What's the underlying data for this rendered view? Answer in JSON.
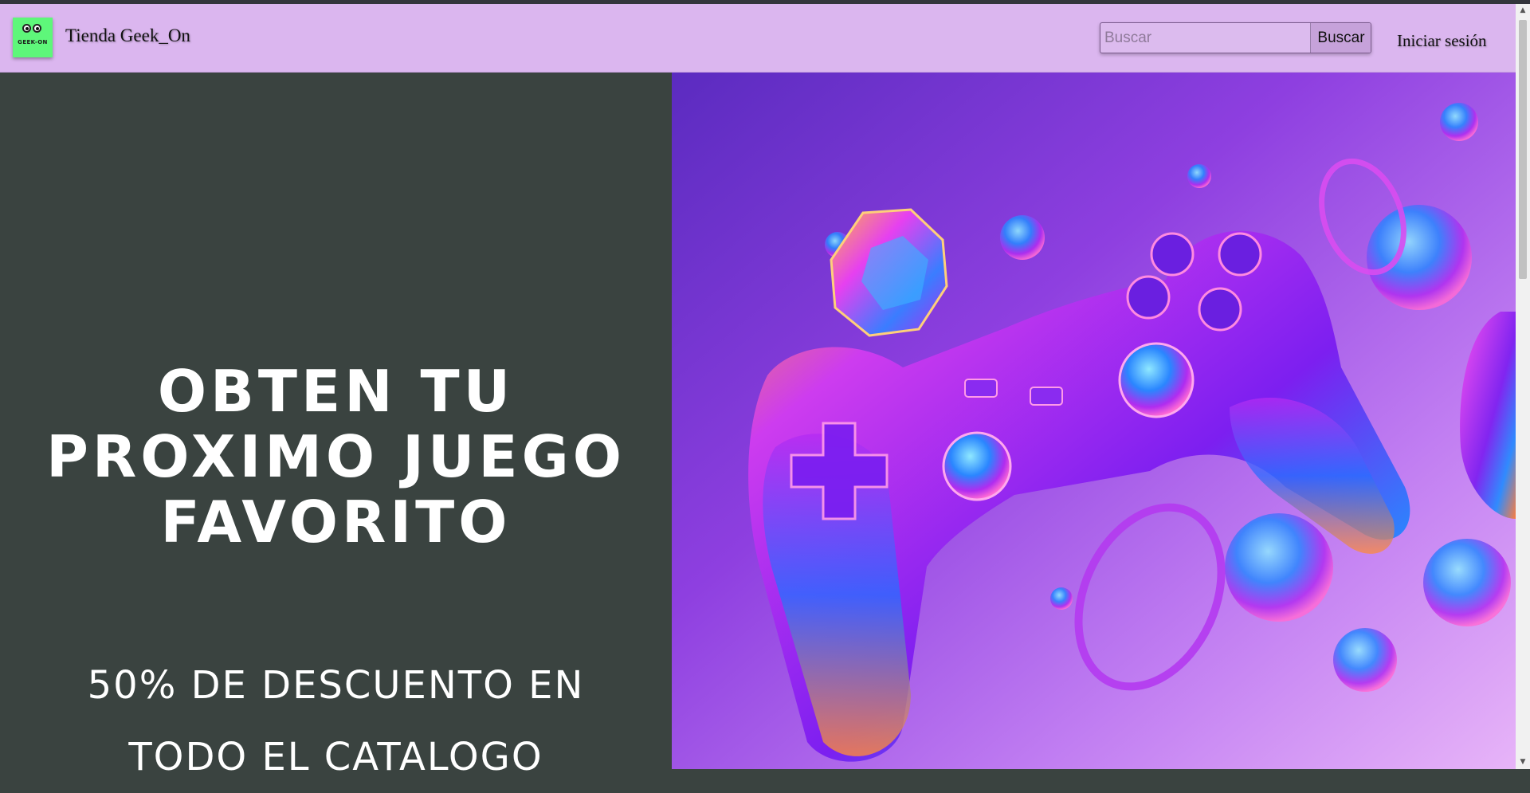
{
  "header": {
    "logo_text": "GEEK-ON",
    "brand": "Tienda Geek_On",
    "search": {
      "placeholder": "Buscar",
      "value": "",
      "button_label": "Buscar"
    },
    "login_label": "Iniciar sesión"
  },
  "hero": {
    "headline_lines": [
      "OBTEN TU",
      "PROXIMO JUEGO",
      "FAVORITO"
    ],
    "subline_lines": [
      "50% DE DESCUENTO EN",
      "TODO EL CATALOGO"
    ],
    "image_subject": "game-controller"
  },
  "colors": {
    "navbar": "#dbb6ef",
    "hero_panel": "#3a4340",
    "logo_bg": "#5ef77a",
    "search_button": "#c6a2da",
    "hero_gradient_start": "#5b2bc0",
    "hero_gradient_end": "#e7b4f8"
  }
}
